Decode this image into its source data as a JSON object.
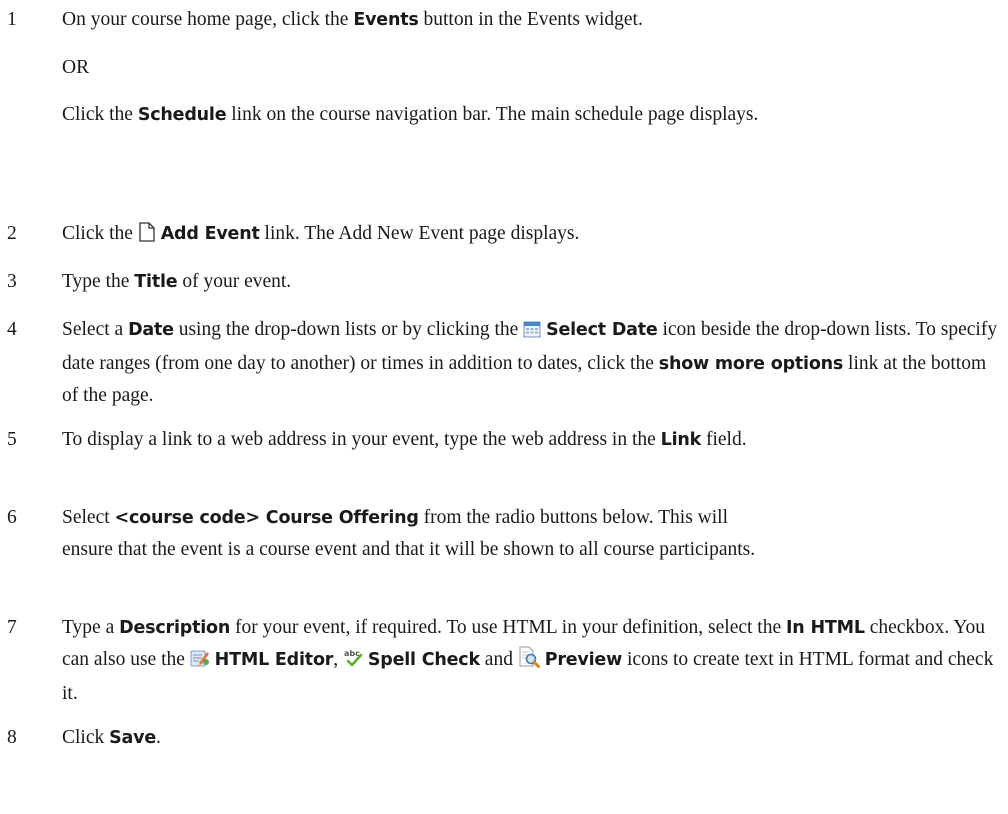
{
  "steps": [
    {
      "number": "1",
      "line1": [
        "On your course home page, click the ",
        "Events",
        " button in the Events widget."
      ],
      "or": "OR",
      "line2": [
        "Click the ",
        "Schedule",
        " link on the course navigation bar. The main schedule page displays."
      ]
    },
    {
      "number": "2",
      "parts": [
        "Click the ",
        "Add Event",
        " link. The Add New Event page displays."
      ]
    },
    {
      "number": "3",
      "parts": [
        "Type the ",
        "Title",
        " of your event."
      ]
    },
    {
      "number": "4",
      "parts": [
        "Select a ",
        "Date",
        " using the drop-down lists or by clicking the ",
        "Select Date",
        " icon beside the drop-down lists. To specify date ranges (from one day to another) or times in addition to dates, click the ",
        "show more options",
        " link at the bottom of the page."
      ]
    },
    {
      "number": "5",
      "parts": [
        "To display a link to a web address in your event, type the web address in the ",
        "Link",
        " field."
      ]
    },
    {
      "number": "6",
      "parts": [
        "Select ",
        "<course code> Course Offering",
        " from the radio buttons below. This will ensure that the event is a course event and that it will be shown to all course participants."
      ]
    },
    {
      "number": "7",
      "parts": [
        "Type a ",
        "Description",
        " for your event, if required. To use HTML in your definition, select the ",
        "In HTML",
        " checkbox. You can also use the ",
        "HTML Editor",
        ", ",
        "Spell Check",
        " and ",
        "Preview",
        " icons to create text in HTML format and check it."
      ]
    },
    {
      "number": "8",
      "parts": [
        "Click ",
        "Save",
        "."
      ]
    }
  ],
  "icons": {
    "add_event": "blank-page-icon",
    "select_date": "calendar-icon",
    "html_editor": "html-editor-icon",
    "spell_check": "spell-check-icon",
    "preview": "preview-magnifier-icon"
  }
}
